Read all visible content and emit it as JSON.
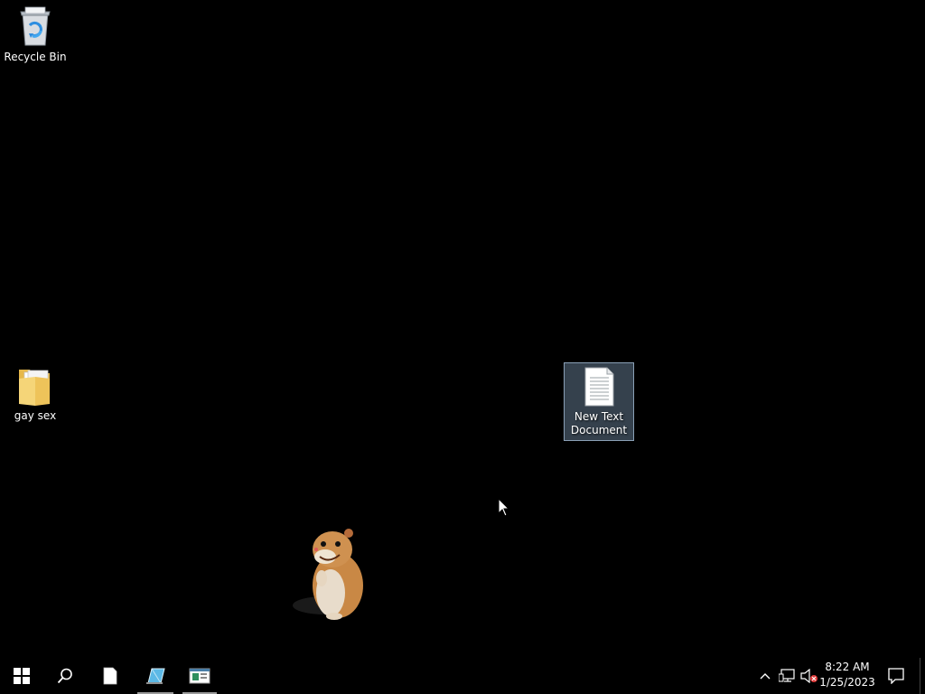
{
  "desktop": {
    "background_color": "#000000",
    "icons": [
      {
        "id": "recycle",
        "label": "Recycle Bin",
        "icon": "recycle-bin-icon",
        "selected": false
      },
      {
        "id": "folder",
        "label": "gay sex",
        "icon": "folder-icon",
        "selected": false
      },
      {
        "id": "textdoc",
        "label": "New Text Document",
        "icon": "text-document-icon",
        "selected": true
      }
    ],
    "widget": {
      "icon": "hamster-desktop-pet-icon"
    },
    "cursor": {
      "icon": "mouse-pointer-icon"
    }
  },
  "taskbar": {
    "start": {
      "icon": "windows-start-icon"
    },
    "search": {
      "icon": "search-icon"
    },
    "pinned": [
      {
        "icon": "notepad-icon",
        "running": false
      },
      {
        "icon": "crystal-app-icon",
        "running": true
      },
      {
        "icon": "window-app-icon",
        "running": true
      }
    ],
    "tray": {
      "chevron": "chevron-up-icon",
      "network": "network-icon",
      "volume": "volume-muted-icon"
    },
    "clock": {
      "time": "8:22 AM",
      "date": "1/25/2023"
    },
    "action_center": {
      "icon": "notification-icon"
    },
    "accent_color": "#9a9a9a"
  }
}
